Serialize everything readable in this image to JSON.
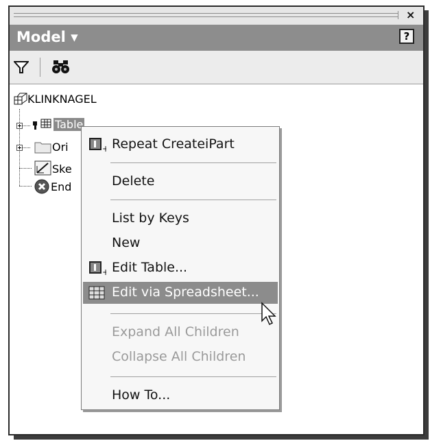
{
  "panel": {
    "title": "Model ▾",
    "help_label": "?",
    "close_label": "×"
  },
  "toolbar": {
    "filter_icon": "filter-icon",
    "find_icon": "binoculars-icon"
  },
  "tree": {
    "root_label": "KLINKNAGEL",
    "items": [
      {
        "label": "Table",
        "icon": "table-icon",
        "selected": true
      },
      {
        "label": "Ori",
        "icon": "folder-icon"
      },
      {
        "label": "Ske",
        "icon": "sketch-icon"
      },
      {
        "label": "End",
        "icon": "end-of-part-icon"
      }
    ]
  },
  "context_menu": {
    "items": [
      {
        "label": "Repeat CreateiPart",
        "mnemonic": "R",
        "icon": "ipart-icon",
        "enabled": true
      },
      {
        "label": "Delete",
        "mnemonic": "D",
        "enabled": true
      },
      {
        "label": "List by Keys",
        "enabled": true
      },
      {
        "label": "New",
        "mnemonic": "N",
        "enabled": true
      },
      {
        "label": "Edit Table...",
        "mnemonic": "E",
        "icon": "ipart-icon",
        "enabled": true
      },
      {
        "label": "Edit via Spreadsheet...",
        "icon": "spreadsheet-icon",
        "enabled": true,
        "highlighted": true
      },
      {
        "label": "Expand All Children",
        "mnemonic": "n",
        "enabled": false
      },
      {
        "label": "Collapse All Children",
        "mnemonic": "s",
        "enabled": false
      },
      {
        "label": "How To...",
        "mnemonic": "H",
        "enabled": true
      }
    ]
  },
  "colors": {
    "title_bar": "#8d8d8d",
    "highlight": "#8c8c8c"
  }
}
